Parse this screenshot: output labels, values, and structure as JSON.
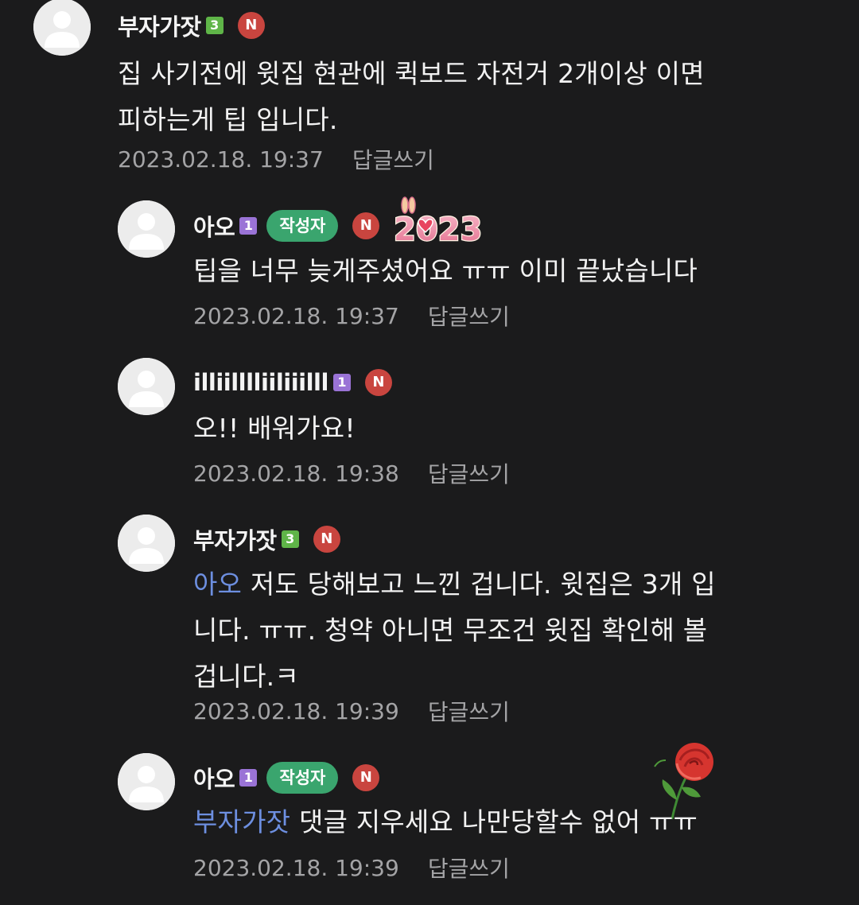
{
  "comments": [
    {
      "nickname": "부자가잣",
      "level": "3",
      "new_badge": "N",
      "body": [
        "집 사기전에 윗집 현관에 퀵보드 자전거 2개이상 이면",
        "피하는게 팁 입니다."
      ],
      "timestamp": "2023.02.18. 19:37",
      "reply_label": "답글쓰기"
    },
    {
      "nickname": "아오",
      "level": "1",
      "author_badge": "작성자",
      "new_badge": "N",
      "sticker_text": "2023",
      "body": [
        "팁을 너무 늦게주셨어요 ㅠㅠ 이미 끝났습니다"
      ],
      "timestamp": "2023.02.18. 19:37",
      "reply_label": "답글쓰기"
    },
    {
      "nickname": "illiilllliiliiilll",
      "level": "1",
      "new_badge": "N",
      "body": [
        "오!! 배워가요!"
      ],
      "timestamp": "2023.02.18. 19:38",
      "reply_label": "답글쓰기"
    },
    {
      "nickname": "부자가잣",
      "level": "3",
      "new_badge": "N",
      "mention": "아오",
      "body": [
        " 저도 당해보고 느낀 겁니다. 윗집은 3개 입",
        "니다. ㅠㅠ. 청약 아니면 무조건 윗집 확인해 볼",
        "겁니다.ㅋ"
      ],
      "timestamp": "2023.02.18. 19:39",
      "reply_label": "답글쓰기"
    },
    {
      "nickname": "아오",
      "level": "1",
      "author_badge": "작성자",
      "new_badge": "N",
      "mention": "부자가잣",
      "body": [
        " 댓글 지우세요 나만당할수 없어 ㅠㅠ"
      ],
      "timestamp": "2023.02.18. 19:39",
      "reply_label": "답글쓰기"
    }
  ],
  "colors": {
    "background": "#1b1b1c",
    "mention": "#6d8fe0",
    "author_badge": "#3aa56e",
    "new_badge": "#c9453f",
    "level3": "#5fb548",
    "level1": "#9a73d6"
  },
  "icons": {
    "avatar": "default-profile-icon",
    "sticker": "rabbit-2023-sticker",
    "emoticon": "rose-sticker"
  }
}
